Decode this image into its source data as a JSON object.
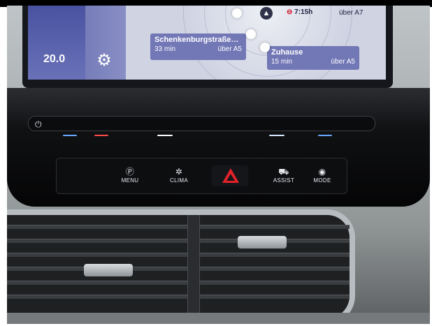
{
  "display": {
    "temperature": "20.0",
    "settings_icon": "gear-icon",
    "destinations": [
      {
        "name": "Schenkenburgstraße…",
        "time": "33 min",
        "via": "über A5"
      },
      {
        "name": "Zuhause",
        "time": "15 min",
        "via": "über A5"
      }
    ],
    "top_route": {
      "time": "7:15h",
      "via": "über A7"
    },
    "route_color": "#d11a2a"
  },
  "controls": {
    "power_icon": "power-icon",
    "menu": "MENU",
    "clima": "CLIMA",
    "hazard_icon": "hazard-warning-icon",
    "assist": "ASSIST",
    "mode": "MODE",
    "hazard_color": "#e3212a"
  }
}
